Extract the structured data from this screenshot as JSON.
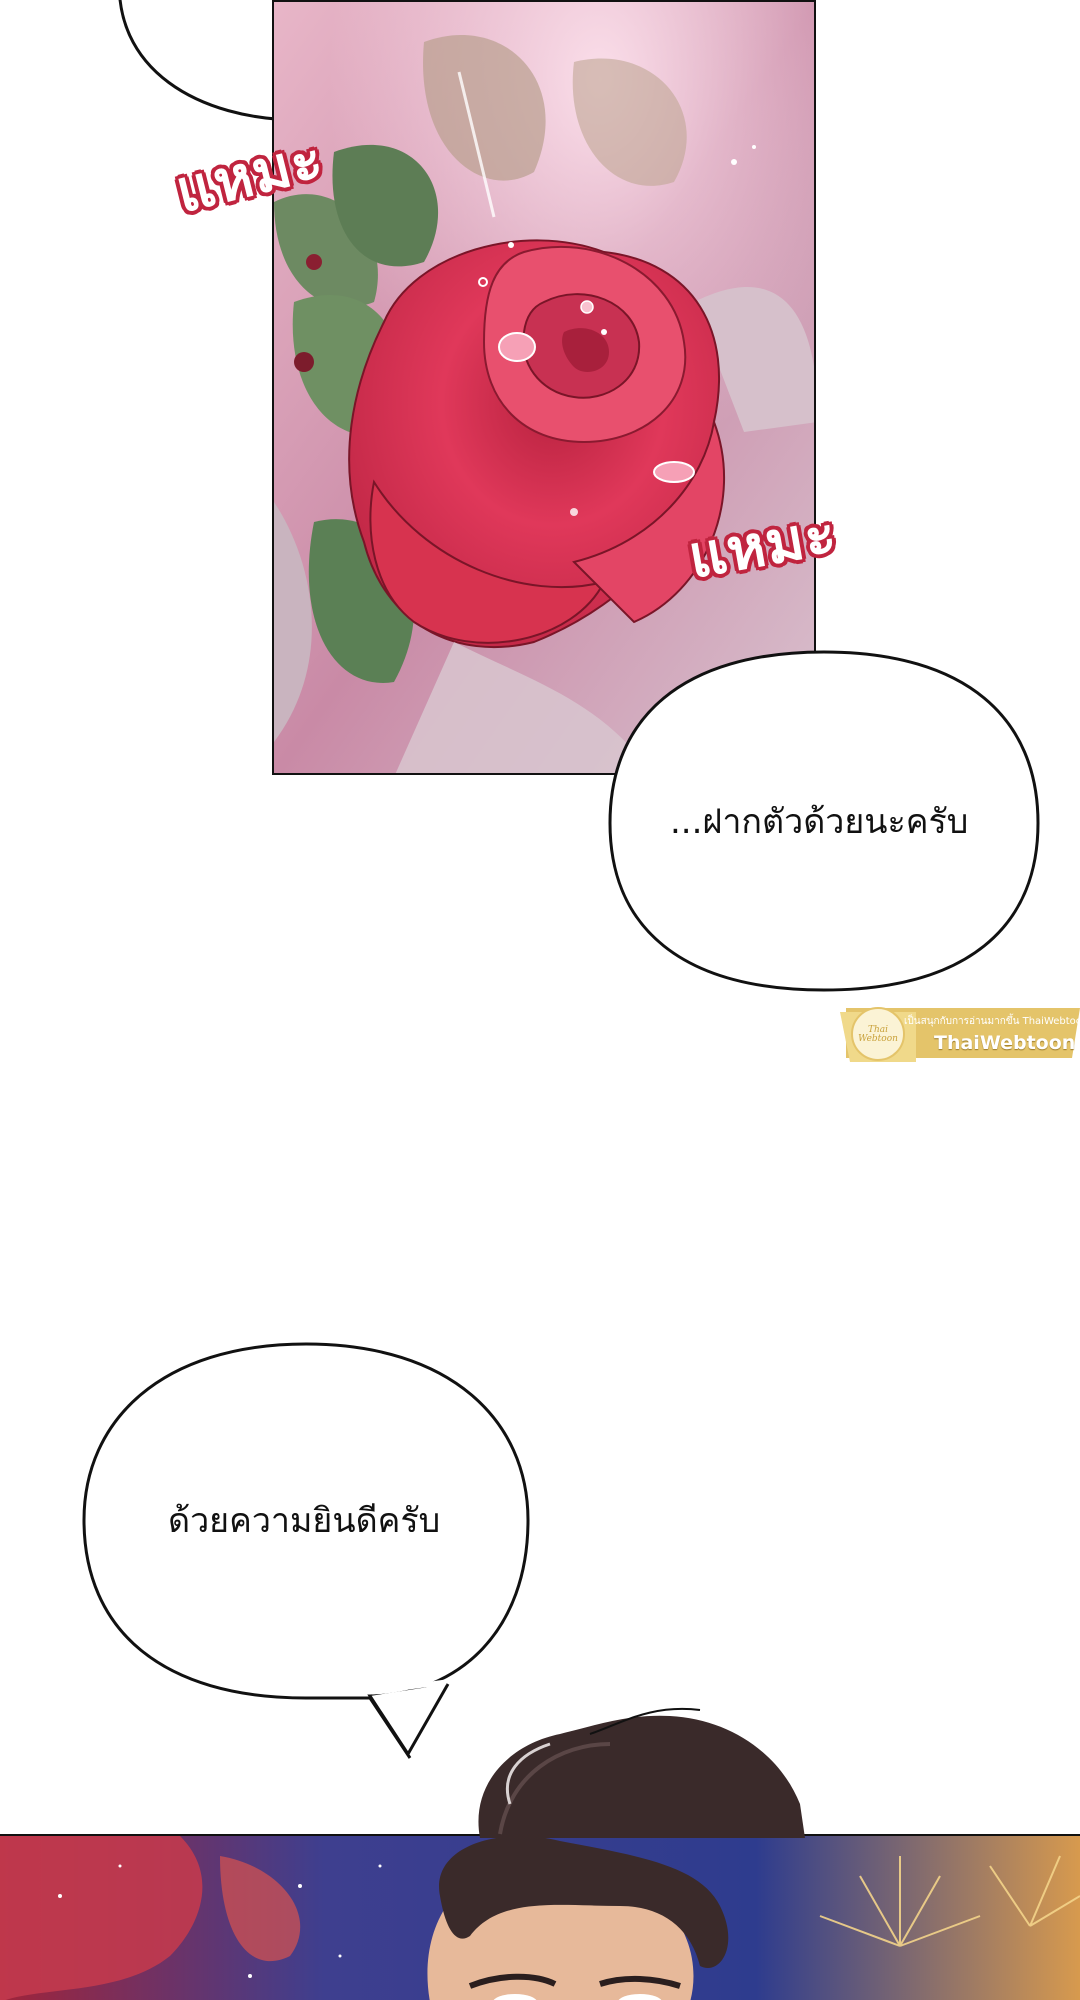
{
  "panels": {
    "rose": {
      "sfx_top": "แหมะ",
      "sfx_right": "แหมะ"
    },
    "speech": {
      "bubble_1": "...ฝากตัวด้วยนะครับ",
      "bubble_2": "ด้วยความยินดีครับ"
    }
  },
  "watermark": {
    "tagline": "เป็นสนุกกับการอ่านมากขึ้น ThaiWebtoon",
    "brand": "ThaiWebtoon",
    "logo_text": "Thai Webtoon"
  },
  "colors": {
    "sfx_outline": "#c0243f",
    "rose": "#d8304f",
    "watermark_gold": "#e4c46a"
  }
}
